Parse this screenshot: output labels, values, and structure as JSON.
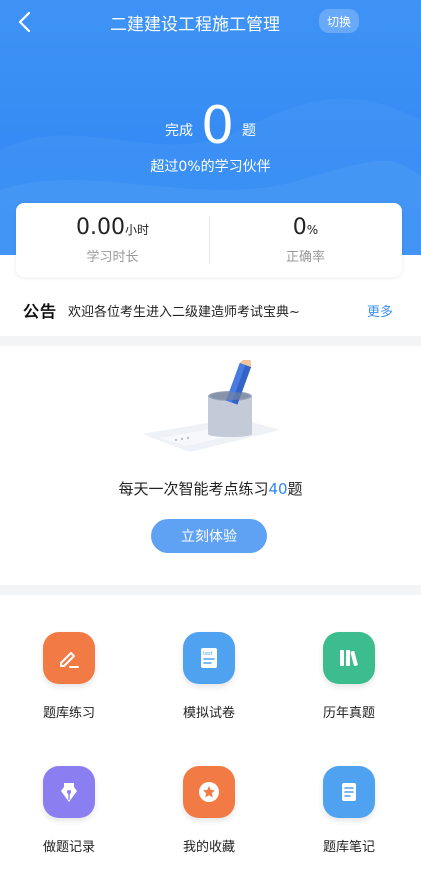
{
  "header": {
    "title": "二建建设工程施工管理",
    "switch_label": "切换"
  },
  "summary": {
    "done_prefix": "完成",
    "done_count": "0",
    "done_suffix": "题",
    "beat_text": "超过0%的学习伙伴"
  },
  "stats": {
    "study_time": {
      "value": "0.00",
      "unit": "小时",
      "label": "学习时长"
    },
    "accuracy": {
      "value": "0",
      "unit": "%",
      "label": "正确率"
    }
  },
  "notice": {
    "tag": "公告",
    "text": "欢迎各位考生进入二级建造师考试宝典~",
    "more": "更多"
  },
  "practice": {
    "text_prefix": "每天一次智能考点练习",
    "count": "40",
    "text_suffix": "题",
    "button": "立刻体验"
  },
  "grid": [
    {
      "label": "题库练习",
      "icon": "edit-icon",
      "color": "#f27a45"
    },
    {
      "label": "模拟试卷",
      "icon": "test-paper-icon",
      "color": "#4ea2ef"
    },
    {
      "label": "历年真题",
      "icon": "books-icon",
      "color": "#3dbd8f"
    },
    {
      "label": "做题记录",
      "icon": "pen-nib-icon",
      "color": "#8a7ef1"
    },
    {
      "label": "我的收藏",
      "icon": "star-icon",
      "color": "#f27a45"
    },
    {
      "label": "题库笔记",
      "icon": "note-icon",
      "color": "#4ea2ef"
    }
  ],
  "colors": {
    "primary": "#2f86f3",
    "accent": "#3f8ff2"
  }
}
